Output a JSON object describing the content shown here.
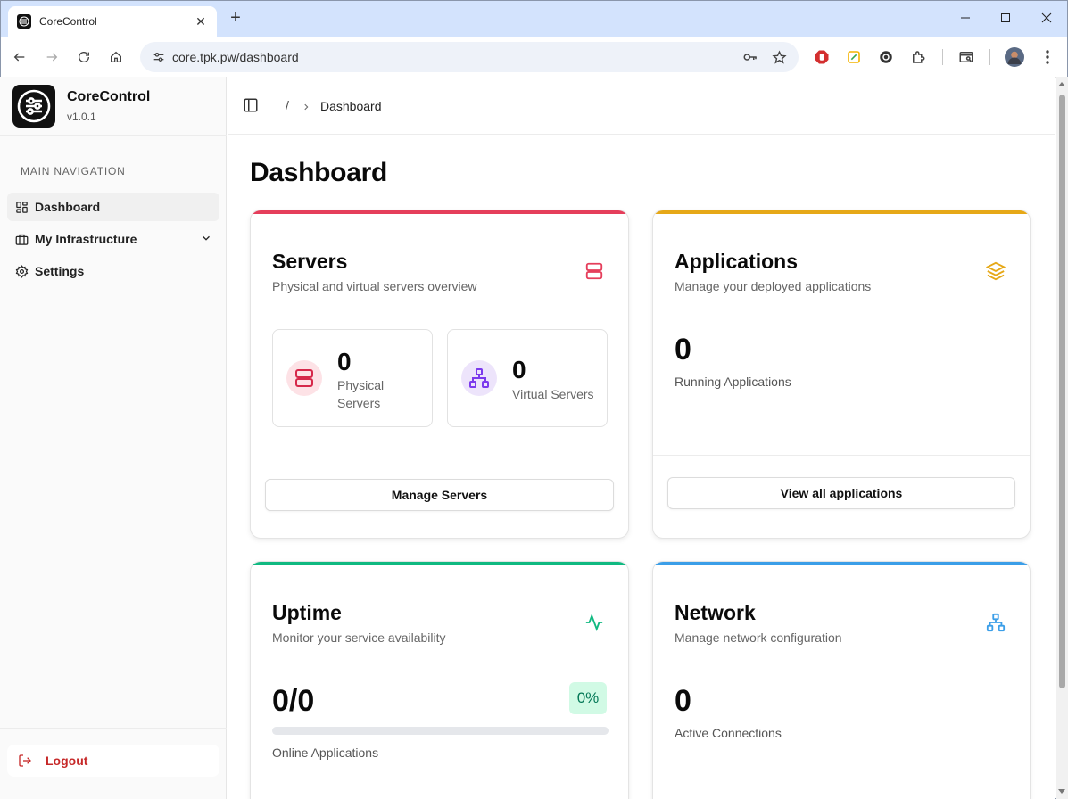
{
  "browser": {
    "tab_title": "CoreControl",
    "url": "core.tpk.pw/dashboard"
  },
  "sidebar": {
    "brand_name": "CoreControl",
    "version": "v1.0.1",
    "nav_heading": "MAIN NAVIGATION",
    "items": [
      {
        "label": "Dashboard",
        "icon": "grid-icon",
        "active": true
      },
      {
        "label": "My Infrastructure",
        "icon": "briefcase-icon",
        "expandable": true
      },
      {
        "label": "Settings",
        "icon": "gear-icon"
      }
    ],
    "logout_label": "Logout"
  },
  "breadcrumb": {
    "separator": "/",
    "current": "Dashboard"
  },
  "page_title": "Dashboard",
  "cards": {
    "servers": {
      "title": "Servers",
      "subtitle": "Physical and virtual servers overview",
      "accent": "#e11d48",
      "physical": {
        "value": "0",
        "label": "Physical Servers"
      },
      "virtual": {
        "value": "0",
        "label": "Virtual Servers"
      },
      "button": "Manage Servers"
    },
    "applications": {
      "title": "Applications",
      "subtitle": "Manage your deployed applications",
      "accent": "#eab308",
      "value": "0",
      "label": "Running Applications",
      "button": "View all applications"
    },
    "uptime": {
      "title": "Uptime",
      "subtitle": "Monitor your service availability",
      "accent": "#10b981",
      "value": "0/0",
      "percent_label": "0%",
      "progress": 0,
      "label": "Online Applications"
    },
    "network": {
      "title": "Network",
      "subtitle": "Manage network configuration",
      "accent": "#3b9ee8",
      "value": "0",
      "label": "Active Connections"
    }
  }
}
